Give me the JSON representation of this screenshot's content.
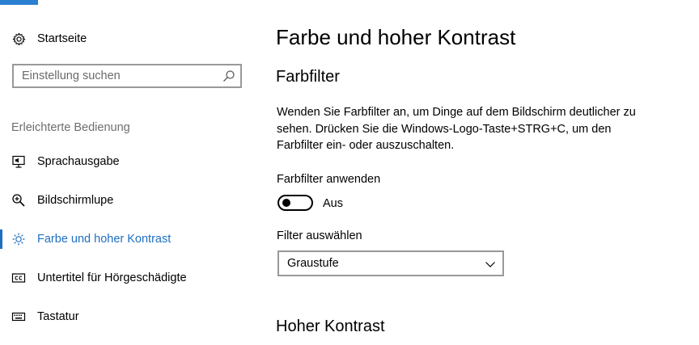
{
  "sidebar": {
    "home_label": "Startseite",
    "search_placeholder": "Einstellung suchen",
    "section_title": "Erleichterte Bedienung",
    "items": [
      {
        "label": "Sprachausgabe",
        "icon": "narrator-icon"
      },
      {
        "label": "Bildschirmlupe",
        "icon": "magnifier-icon"
      },
      {
        "label": "Farbe und hoher Kontrast",
        "icon": "brightness-icon",
        "active": true
      },
      {
        "label": "Untertitel für Hörgeschädigte",
        "icon": "closed-captions-icon"
      },
      {
        "label": "Tastatur",
        "icon": "keyboard-icon"
      }
    ]
  },
  "main": {
    "title": "Farbe und hoher Kontrast",
    "color_filter": {
      "heading": "Farbfilter",
      "description": "Wenden Sie Farbfilter an, um Dinge auf dem Bildschirm deutlicher zu sehen. Drücken Sie die Windows-Logo-Taste+STRG+C, um den Farbfilter ein- oder auszuschalten.",
      "apply_label": "Farbfilter anwenden",
      "toggle_state": "Aus",
      "toggle_on": false,
      "select_label": "Filter auswählen",
      "selected_filter": "Graustufe"
    },
    "high_contrast": {
      "heading": "Hoher Kontrast"
    }
  },
  "colors": {
    "accent": "#1f6fc1",
    "top_strip": "#2b7fd1"
  }
}
